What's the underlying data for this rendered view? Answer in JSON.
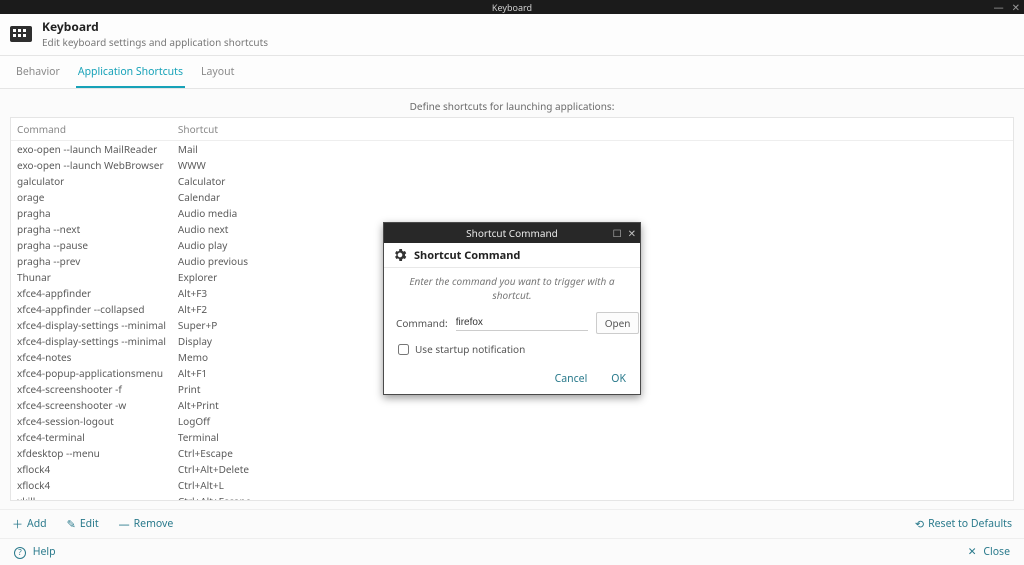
{
  "window": {
    "title": "Keyboard"
  },
  "header": {
    "title": "Keyboard",
    "subtitle": "Edit keyboard settings and application shortcuts"
  },
  "tabs": {
    "behavior": "Behavior",
    "shortcuts": "Application Shortcuts",
    "layout": "Layout"
  },
  "hint": "Define shortcuts for launching applications:",
  "columns": {
    "command": "Command",
    "shortcut": "Shortcut"
  },
  "rows": [
    {
      "cmd": "exo-open --launch MailReader",
      "key": "Mail"
    },
    {
      "cmd": "exo-open --launch WebBrowser",
      "key": "WWW"
    },
    {
      "cmd": "galculator",
      "key": "Calculator"
    },
    {
      "cmd": "orage",
      "key": "Calendar"
    },
    {
      "cmd": "pragha",
      "key": "Audio media"
    },
    {
      "cmd": "pragha --next",
      "key": "Audio next"
    },
    {
      "cmd": "pragha --pause",
      "key": "Audio play"
    },
    {
      "cmd": "pragha --prev",
      "key": "Audio previous"
    },
    {
      "cmd": "Thunar",
      "key": "Explorer"
    },
    {
      "cmd": "xfce4-appfinder",
      "key": "Alt+F3"
    },
    {
      "cmd": "xfce4-appfinder --collapsed",
      "key": "Alt+F2"
    },
    {
      "cmd": "xfce4-display-settings --minimal",
      "key": "Super+P"
    },
    {
      "cmd": "xfce4-display-settings --minimal",
      "key": "Display"
    },
    {
      "cmd": "xfce4-notes",
      "key": "Memo"
    },
    {
      "cmd": "xfce4-popup-applicationsmenu",
      "key": "Alt+F1"
    },
    {
      "cmd": "xfce4-screenshooter -f",
      "key": "Print"
    },
    {
      "cmd": "xfce4-screenshooter -w",
      "key": "Alt+Print"
    },
    {
      "cmd": "xfce4-session-logout",
      "key": "LogOff"
    },
    {
      "cmd": "xfce4-terminal",
      "key": "Terminal"
    },
    {
      "cmd": "xfdesktop --menu",
      "key": "Ctrl+Escape"
    },
    {
      "cmd": "xflock4",
      "key": "Ctrl+Alt+Delete"
    },
    {
      "cmd": "xflock4",
      "key": "Ctrl+Alt+L"
    },
    {
      "cmd": "xkill",
      "key": "Ctrl+Alt+Escape"
    }
  ],
  "actions": {
    "add": "Add",
    "edit": "Edit",
    "remove": "Remove",
    "reset": "Reset to Defaults"
  },
  "footer": {
    "help": "Help",
    "close": "Close"
  },
  "dialog": {
    "wintitle": "Shortcut Command",
    "title": "Shortcut Command",
    "instruction": "Enter the command you want to trigger with a shortcut.",
    "command_label": "Command:",
    "command_value": "firefox",
    "open": "Open",
    "startup_label": "Use startup notification",
    "startup_checked": false,
    "cancel": "Cancel",
    "ok": "OK"
  }
}
